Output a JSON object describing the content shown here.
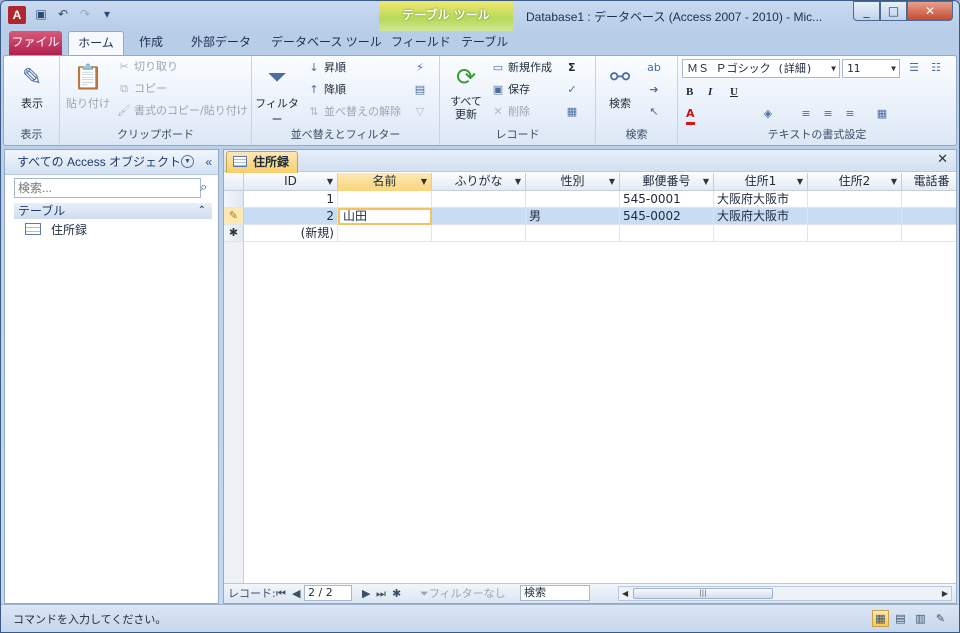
{
  "window": {
    "title": "Database1 : データベース (Access 2007 - 2010)  -  Mic...",
    "context_tool": "テーブル ツール",
    "min": "_",
    "max": "□",
    "close": "✕"
  },
  "ribbon_tabs": [
    "ファイル",
    "ホーム",
    "作成",
    "外部データ",
    "データベース ツール",
    "フィールド",
    "テーブル"
  ],
  "ribbon": {
    "views": {
      "button": "表示",
      "group": "表示"
    },
    "clipboard": {
      "paste": "貼り付け",
      "cut": "切り取り",
      "copy": "コピー",
      "format_painter": "書式のコピー/貼り付け",
      "group": "クリップボード"
    },
    "sort": {
      "filter": "フィルター",
      "asc": "昇順",
      "desc": "降順",
      "clear": "並べ替えの解除",
      "group": "並べ替えとフィルター"
    },
    "records": {
      "refresh": "すべて\n更新",
      "new": "新規作成",
      "save": "保存",
      "delete": "削除",
      "sum": "Σ",
      "group": "レコード"
    },
    "find": {
      "find": "検索",
      "group": "検索"
    },
    "text": {
      "font": "ＭＳ Ｐゴシック (詳細)",
      "size": "11",
      "bold": "B",
      "italic": "I",
      "underline": "U",
      "group": "テキストの書式設定"
    }
  },
  "nav": {
    "header": "すべての Access オブジェクト",
    "search_placeholder": "検索...",
    "section": "テーブル",
    "items": [
      {
        "label": "住所録"
      }
    ]
  },
  "document": {
    "tab": "住所録",
    "columns": [
      "ID",
      "名前",
      "ふりがな",
      "性別",
      "郵便番号",
      "住所1",
      "住所2",
      "電話番"
    ],
    "rows": [
      {
        "id": "1",
        "name": "",
        "kana": "",
        "sex": "",
        "zip": "545-0001",
        "addr1": "大阪府大阪市",
        "addr2": "",
        "tel": ""
      },
      {
        "id": "2",
        "name": "山田",
        "kana": "",
        "sex": "男",
        "zip": "545-0002",
        "addr1": "大阪府大阪市",
        "addr2": "",
        "tel": ""
      }
    ],
    "new_row": "(新規)",
    "record_nav": {
      "label": "レコード:",
      "current": "2 / 2",
      "filter": "フィルターなし",
      "search": "検索"
    }
  },
  "status": {
    "text": "コマンドを入力してください。"
  }
}
